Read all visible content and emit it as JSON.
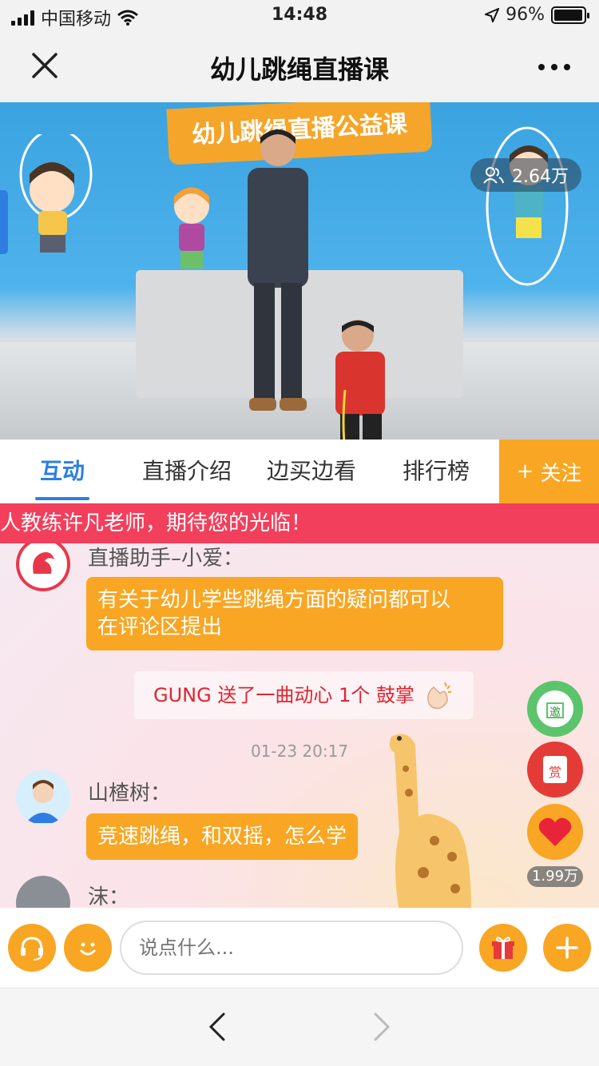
{
  "status_bar": {
    "carrier": "中国移动",
    "time": "14:48",
    "battery": "96%"
  },
  "nav": {
    "title": "幼儿跳绳直播课"
  },
  "video": {
    "banner": "幼儿跳绳直播公益课",
    "viewers": "2.64万"
  },
  "tabs": {
    "items": [
      {
        "label": "互动"
      },
      {
        "label": "直播介绍"
      },
      {
        "label": "边买边看"
      },
      {
        "label": "排行榜"
      }
    ],
    "follow_label": "关注"
  },
  "marquee": "人教练许凡老师，期待您的光临！",
  "chat": {
    "messages": [
      {
        "name": "直播助手–小爱：",
        "text_line1": "有关于幼儿学些跳绳方面的疑问都可以",
        "text_line2": "在评论区提出"
      },
      {
        "gift": "GUNG 送了一曲动心 1个 鼓掌"
      },
      {
        "timestamp": "01-23 20:17"
      },
      {
        "name": "山楂树：",
        "text": "竞速跳绳，和双摇，怎么学"
      },
      {
        "name": "沫："
      }
    ]
  },
  "side": {
    "invite": "邀",
    "reward": "赏",
    "likes": "1.99万"
  },
  "input": {
    "placeholder": "说点什么..."
  },
  "colors": {
    "accent": "#f8a623",
    "tab_active": "#2c7fe0",
    "marquee": "#f23f5c"
  }
}
